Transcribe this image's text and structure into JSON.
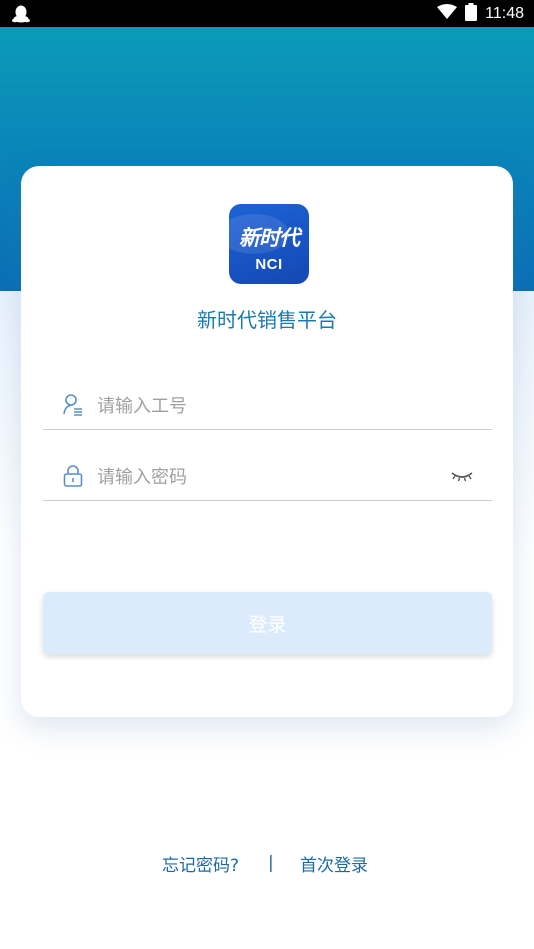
{
  "status_bar": {
    "time": "11:48",
    "left_icon": "qq-penguin-icon",
    "wifi_icon": "wifi-icon",
    "battery_icon": "battery-icon"
  },
  "colors": {
    "header_gradient_top": "#0a9bb8",
    "header_gradient_bottom": "#0a6fb6",
    "accent": "#1a7bb0",
    "button_disabled": "#dcebfb",
    "logo_blue": "#1d63d6"
  },
  "logo": {
    "script_text": "新时代",
    "badge_text": "NCI"
  },
  "app_title": "新时代销售平台",
  "form": {
    "username": {
      "placeholder": "请输入工号",
      "value": "",
      "icon": "user-icon"
    },
    "password": {
      "placeholder": "请输入密码",
      "value": "",
      "icon": "lock-icon",
      "toggle_icon": "eye-closed-icon"
    },
    "login_label": "登录"
  },
  "footer": {
    "forgot_label": "忘记密码?",
    "divider": "|",
    "first_login_label": "首次登录"
  }
}
